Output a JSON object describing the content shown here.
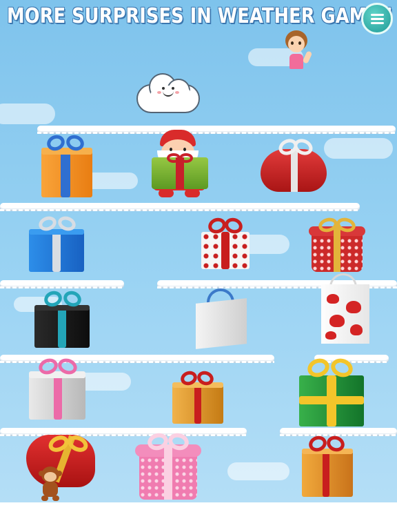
{
  "game": {
    "title": "MORE SURPRISES IN WEATHER GAME !",
    "menu_icon": "hamburger-menu-icon"
  },
  "characters": [
    "cloud-face",
    "girl-waving",
    "santa-claus",
    "monkey"
  ],
  "shelves": [
    {
      "row": 1,
      "items": [
        "orange-gift-box",
        "santa-holding-green-gift",
        "red-heart-gift-box"
      ]
    },
    {
      "row": 2,
      "items": [
        "blue-gift-box",
        "white-red-dotted-gift-box",
        "red-round-gift-box"
      ]
    },
    {
      "row": 3,
      "items": [
        "black-gift-box",
        "white-gift-bag",
        "red-hearts-gift-bag"
      ]
    },
    {
      "row": 4,
      "items": [
        "pink-silver-gift-box",
        "gold-gift-box",
        "green-gift-box"
      ]
    },
    {
      "row": 5,
      "items": [
        "red-heart-gift-box-2",
        "pink-dotted-round-gift-box",
        "orange-gift-box-2"
      ]
    }
  ],
  "colors": {
    "sky": "#8fcdf1",
    "title_outline": "#3b77b0",
    "menu_button": "#2bb0aa"
  }
}
